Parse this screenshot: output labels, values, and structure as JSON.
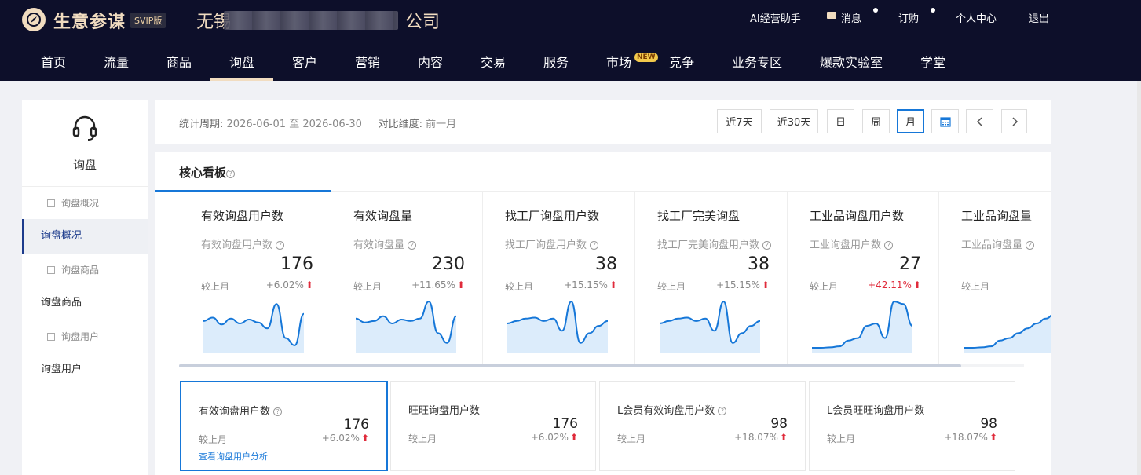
{
  "header": {
    "brand": "生意参谋",
    "badge": "SVIP版",
    "company": "无锡",
    "company_tail": "公司",
    "links": [
      "AI经营助手",
      "消息",
      "订购",
      "个人中心",
      "退出"
    ]
  },
  "nav": {
    "items": [
      "首页",
      "流量",
      "商品",
      "询盘",
      "客户",
      "营销",
      "内容",
      "交易",
      "服务",
      "市场",
      "竞争",
      "业务专区",
      "爆款实验室",
      "学堂"
    ],
    "active": "询盘",
    "new_badge": "NEW"
  },
  "sidebar": {
    "title": "询盘",
    "items": [
      {
        "label": "询盘概况",
        "type": "sub"
      },
      {
        "label": "询盘概况",
        "type": "active"
      },
      {
        "label": "询盘商品",
        "type": "sub"
      },
      {
        "label": "询盘商品",
        "type": "main"
      },
      {
        "label": "询盘用户",
        "type": "sub"
      },
      {
        "label": "询盘用户",
        "type": "main"
      }
    ]
  },
  "filter": {
    "period_label": "统计周期:",
    "period_value": "2026-06-01 至 2026-06-30",
    "compare_label": "对比维度:",
    "compare_value": "前一月",
    "buttons": [
      "近7天",
      "近30天",
      "日",
      "周",
      "月"
    ],
    "active_button": "月"
  },
  "board": {
    "title": "核心看板",
    "cards": [
      {
        "title": "有效询盘用户数",
        "sub": "有效询盘用户数",
        "value": "176",
        "compare": "较上月",
        "pct": "+6.02%",
        "trend": [
          0.55,
          0.62,
          0.48,
          0.6,
          0.5,
          0.58,
          0.52,
          0.4,
          0.9,
          0.2,
          0.05,
          0.7
        ]
      },
      {
        "title": "有效询盘量",
        "sub": "有效询盘量",
        "value": "230",
        "compare": "较上月",
        "pct": "+11.65%",
        "trend": [
          0.6,
          0.52,
          0.55,
          0.65,
          0.5,
          0.58,
          0.55,
          0.6,
          0.95,
          0.3,
          0.1,
          0.65
        ]
      },
      {
        "title": "找工厂询盘用户数",
        "sub": "找工厂询盘用户数",
        "value": "38",
        "compare": "较上月",
        "pct": "+15.15%",
        "trend": [
          0.5,
          0.55,
          0.6,
          0.62,
          0.55,
          0.6,
          0.35,
          0.95,
          0.1,
          0.3,
          0.45,
          0.55
        ]
      },
      {
        "title": "找工厂完美询盘",
        "sub": "找工厂完美询盘用户数",
        "value": "38",
        "compare": "较上月",
        "pct": "+15.15%",
        "trend": [
          0.5,
          0.55,
          0.6,
          0.62,
          0.55,
          0.6,
          0.35,
          0.95,
          0.1,
          0.3,
          0.45,
          0.55
        ]
      },
      {
        "title": "工业品询盘用户数",
        "sub": "工业询盘用户数",
        "value": "27",
        "compare": "较上月",
        "pct": "+42.11%",
        "trend": [
          0.0,
          0.0,
          0.01,
          0.03,
          0.15,
          0.2,
          0.45,
          0.5,
          0.2,
          0.95,
          0.9,
          0.45
        ]
      },
      {
        "title": "工业品询盘量",
        "sub": "工业品询盘量",
        "value": "",
        "compare": "较上月",
        "pct": "",
        "trend": [
          0.0,
          0.0,
          0.01,
          0.03,
          0.15,
          0.2,
          0.3,
          0.4,
          0.5,
          0.6,
          0.7,
          0.75
        ]
      }
    ],
    "bottom_cards": [
      {
        "title": "有效询盘用户数",
        "value": "176",
        "compare": "较上月",
        "pct": "+6.02%",
        "link": "查看询盘用户分析"
      },
      {
        "title": "旺旺询盘用户数",
        "value": "176",
        "compare": "较上月",
        "pct": "+6.02%"
      },
      {
        "title": "L会员有效询盘用户数",
        "value": "98",
        "compare": "较上月",
        "pct": "+18.07%"
      },
      {
        "title": "L会员旺旺询盘用户数",
        "value": "98",
        "compare": "较上月",
        "pct": "+18.07%"
      }
    ]
  },
  "colors": {
    "accent": "#1677d8",
    "brand": "#f1dcc0",
    "up": "#e02b3b",
    "header_bg": "#0d0f2a"
  }
}
